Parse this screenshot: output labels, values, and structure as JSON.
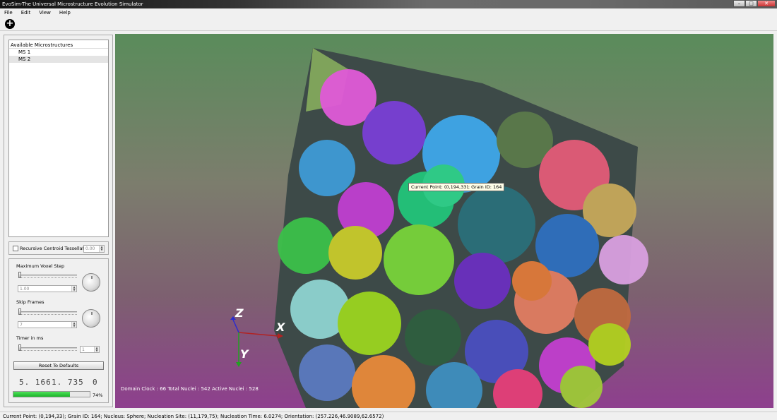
{
  "window": {
    "title": "EvoSim-The Universal Microstructure Evolution Simulator",
    "minimize": "–",
    "maximize": "□",
    "close": "✕"
  },
  "menu": [
    "File",
    "Edit",
    "View",
    "Help"
  ],
  "toolbar": {
    "add_icon": "plus-circle-icon",
    "add_glyph": "+"
  },
  "microstructures": {
    "header": "Available Microstructures",
    "items": [
      "MS 1",
      "MS 2"
    ],
    "selected": "MS 2"
  },
  "rct": {
    "label": "Recursive Centroid Tessellation",
    "checked": false,
    "value": "0.00"
  },
  "params": {
    "max_voxel_step": {
      "label": "Maximum Voxel Step",
      "value": "1.00"
    },
    "skip_frames": {
      "label": "Skip Frames",
      "value": "7"
    },
    "timer": {
      "label": "Timer in ms",
      "value": "1"
    },
    "reset_label": "Reset To Defaults",
    "lcd_left": "5. 166",
    "lcd_mid": "1. 735",
    "lcd_right": "0",
    "progress": 74,
    "progress_label": "74%"
  },
  "viewport": {
    "tooltip": "Current Point: (0,194,33); Grain ID: 164",
    "status": "Domain Clock : 66  Total Nuclei : 542  Active Nuclei : 528",
    "axes": {
      "x": "X",
      "y": "Y",
      "z": "Z"
    }
  },
  "statusbar": "Current Point: (0,194,33); Grain ID: 164; Nucleus: Sphere; Nucleation Site: (11,179,75); Nucleation Time: 6.0274; Orientation: (257.226,46.9089,62.6572)"
}
